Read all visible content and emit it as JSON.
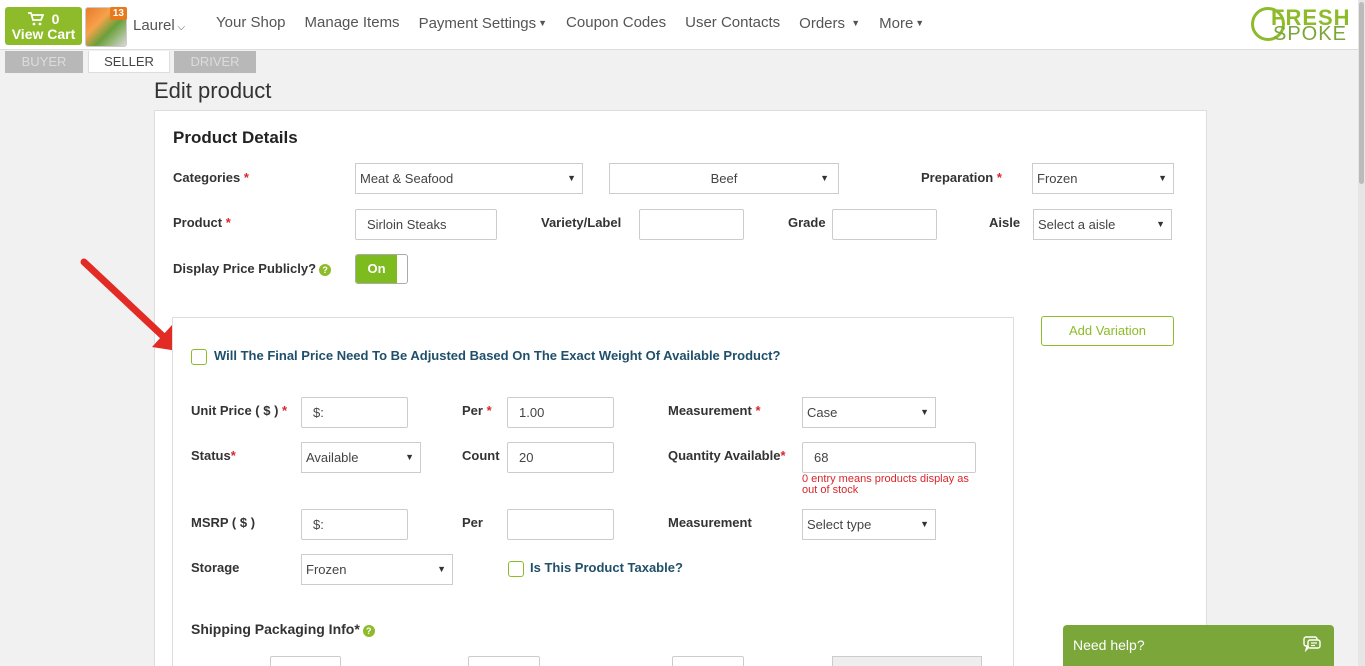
{
  "cart": {
    "count": "0",
    "label": "View Cart"
  },
  "avatar": {
    "badge": "13"
  },
  "user": {
    "name": "Laurel"
  },
  "nav": [
    {
      "label": "Your Shop",
      "dropdown": false
    },
    {
      "label": "Manage Items",
      "dropdown": false
    },
    {
      "label": "Payment Settings",
      "dropdown": true
    },
    {
      "label": "Coupon Codes",
      "dropdown": false
    },
    {
      "label": "User Contacts",
      "dropdown": false
    },
    {
      "label": "Orders",
      "dropdown": true
    },
    {
      "label": "More",
      "dropdown": true
    }
  ],
  "logo": {
    "line1": "FRESH",
    "line2": "SPOKE"
  },
  "roles": {
    "buyer": "BUYER",
    "seller": "SELLER",
    "driver": "DRIVER"
  },
  "page": {
    "title": "Edit product"
  },
  "details": {
    "title": "Product Details",
    "categories_label": "Categories",
    "category_value": "Meat & Seafood",
    "subcategory_value": "Beef",
    "preparation_label": "Preparation",
    "preparation_value": "Frozen",
    "product_label": "Product",
    "product_value": "Sirloin Steaks",
    "variety_label": "Variety/Label",
    "grade_label": "Grade",
    "aisle_label": "Aisle",
    "aisle_placeholder": "Select a aisle",
    "display_price_label": "Display Price Publicly?",
    "toggle_value": "On"
  },
  "variation": {
    "add_label": "Add Variation",
    "weight_question": "Will The Final Price Need To Be Adjusted Based On The Exact Weight Of Available Product?",
    "unit_price_label": "Unit Price ( $ )",
    "unit_price_placeholder": "$:",
    "per_label": "Per",
    "per_value": "1.00",
    "measurement_label": "Measurement",
    "measurement_value": "Case",
    "status_label": "Status",
    "status_value": "Available",
    "count_label": "Count",
    "count_value": "20",
    "qty_label": "Quantity Available",
    "qty_value": "68",
    "qty_hint": "0 entry means products display as out of stock",
    "msrp_label": "MSRP ( $ )",
    "msrp_placeholder": "$:",
    "per2_label": "Per",
    "measurement2_label": "Measurement",
    "measurement2_value": "Select type",
    "storage_label": "Storage",
    "storage_value": "Frozen",
    "taxable_label": "Is This Product Taxable?",
    "shipping_label": "Shipping Packaging Info*"
  },
  "help_widget": {
    "label": "Need help?"
  },
  "colors": {
    "brand_green": "#8dbb2a",
    "required_red": "#d9262a",
    "toggle_green": "#7dbb1f"
  }
}
